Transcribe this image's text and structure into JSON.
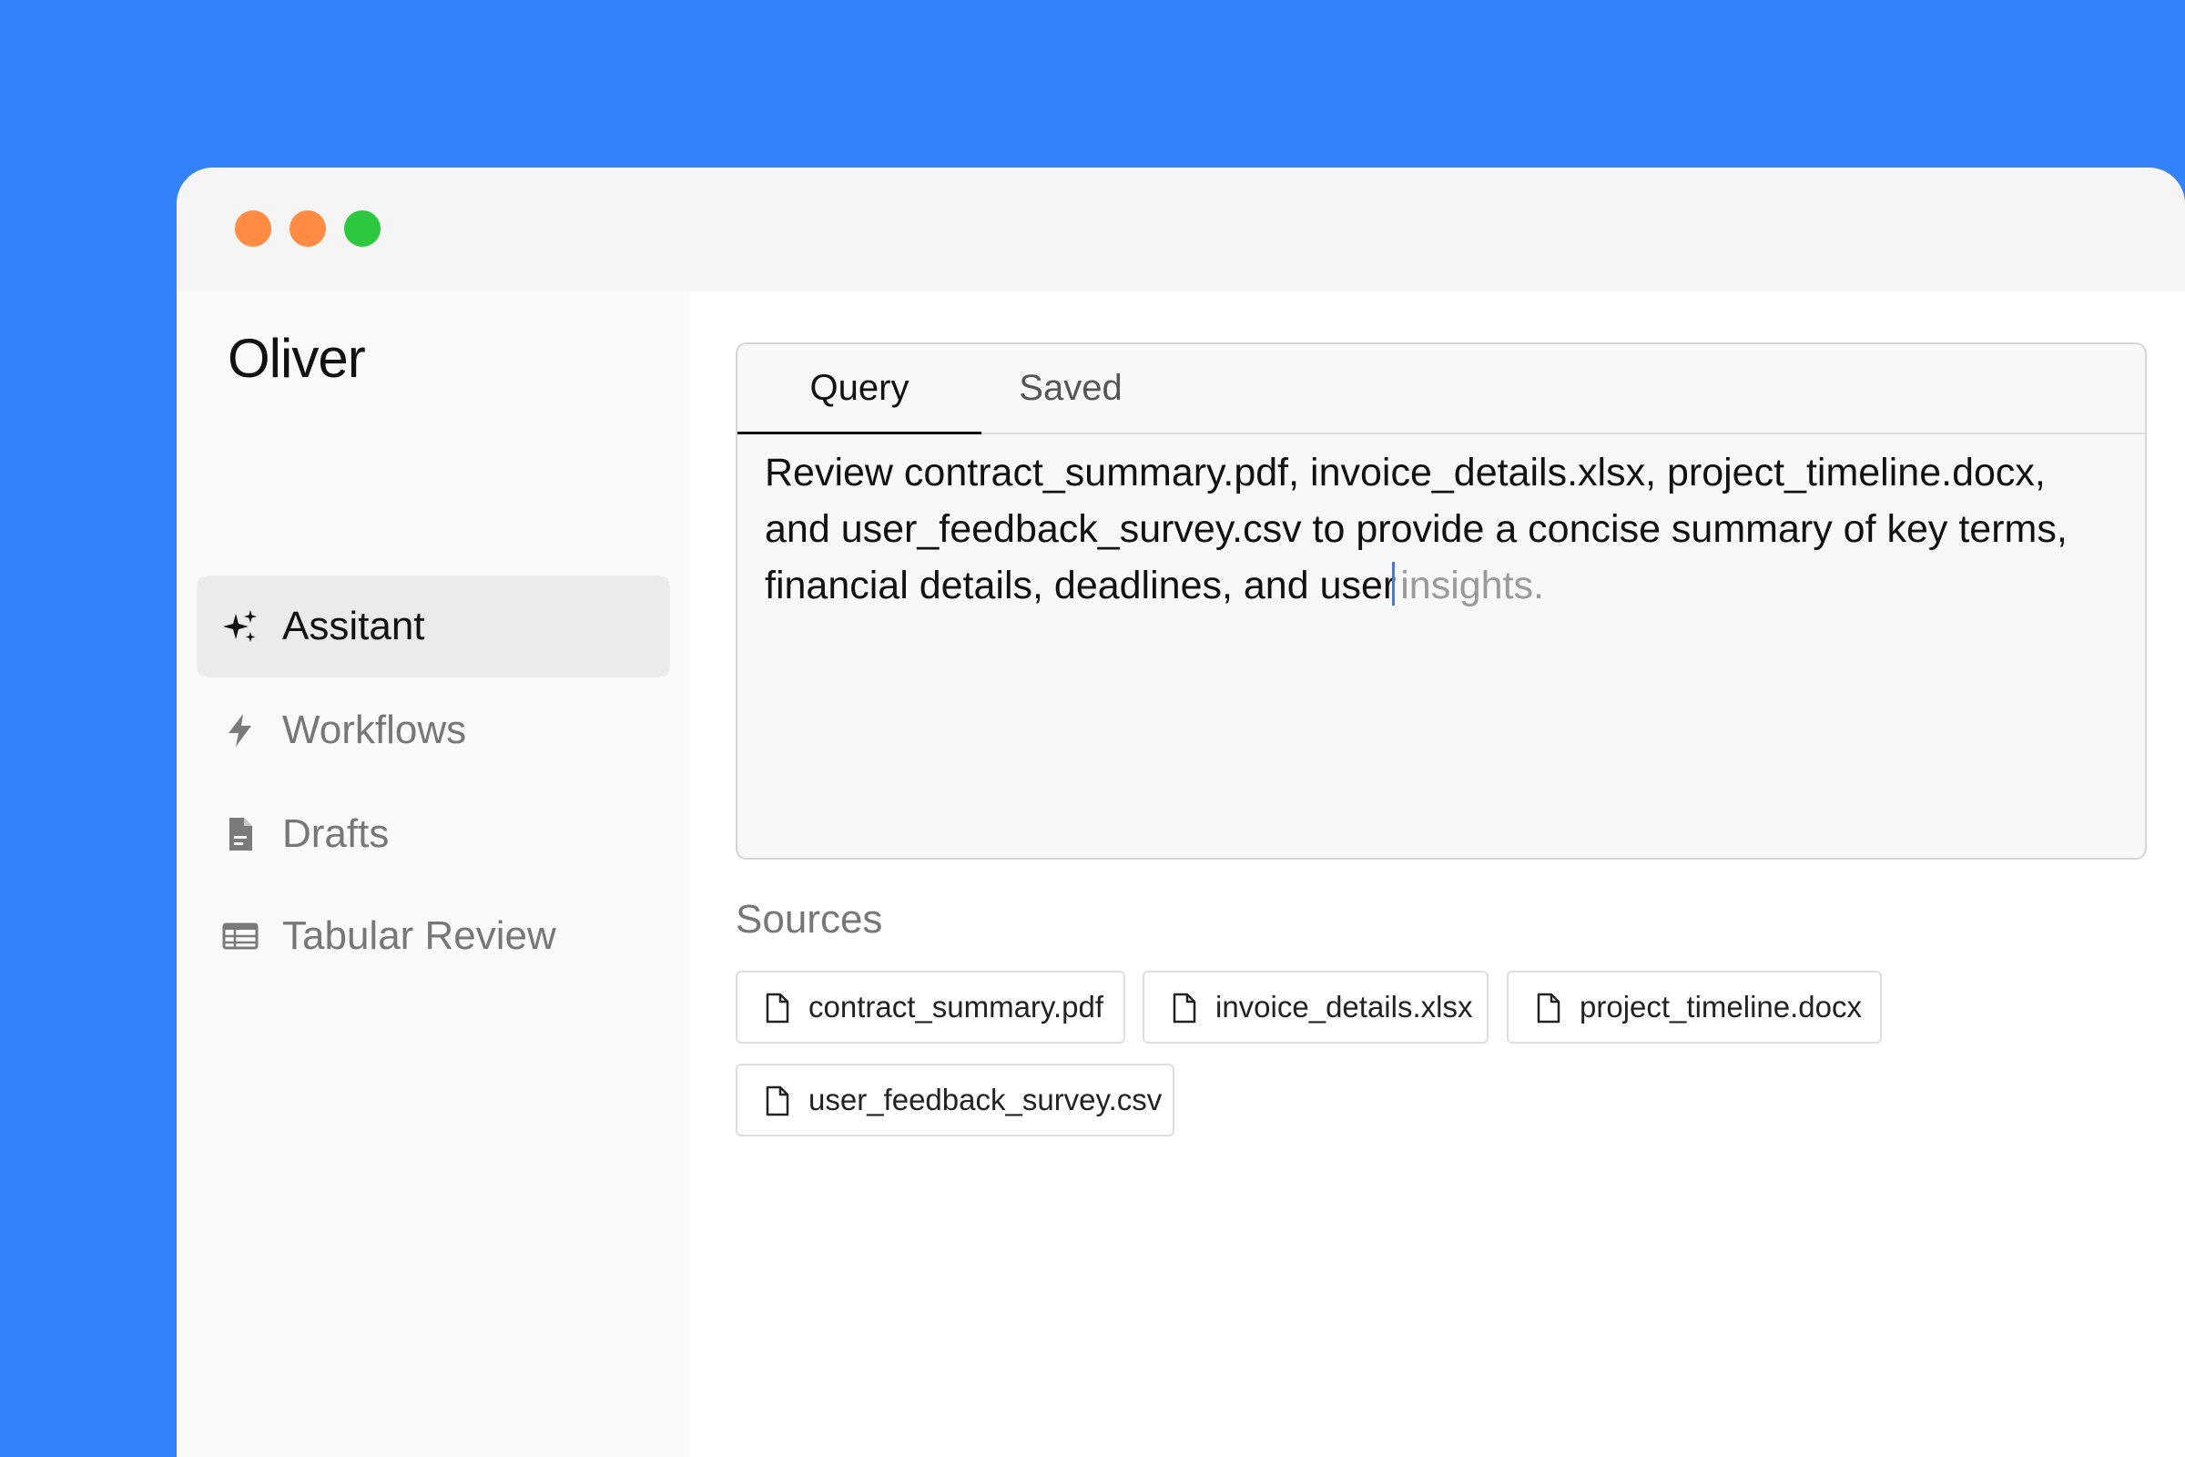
{
  "window": {
    "controls": [
      {
        "name": "close",
        "color": "#FF8C42"
      },
      {
        "name": "minimize",
        "color": "#FF8C42"
      },
      {
        "name": "maximize",
        "color": "#2DC840"
      }
    ]
  },
  "sidebar": {
    "app_name": "Oliver",
    "items": [
      {
        "label": "Assitant",
        "icon": "sparkles-icon",
        "active": true
      },
      {
        "label": "Workflows",
        "icon": "lightning-bolt-icon",
        "active": false
      },
      {
        "label": "Drafts",
        "icon": "document-icon",
        "active": false
      },
      {
        "label": "Tabular Review",
        "icon": "table-icon",
        "active": false
      }
    ]
  },
  "main": {
    "tabs": [
      {
        "label": "Query",
        "active": true
      },
      {
        "label": "Saved",
        "active": false
      }
    ],
    "query": {
      "typed_text": "Review contract_summary.pdf, invoice_details.xlsx, project_timeline.docx, and user_feedback_survey.csv to provide a concise summary of key terms, financial details, deadlines, and user",
      "suggestion_text": "insights."
    },
    "sources": {
      "label": "Sources",
      "files": [
        {
          "name": "contract_summary.pdf",
          "icon": "file-icon"
        },
        {
          "name": "invoice_details.xlsx",
          "icon": "file-icon"
        },
        {
          "name": "project_timeline.docx",
          "icon": "file-icon"
        },
        {
          "name": "user_feedback_survey.csv",
          "icon": "file-icon"
        }
      ]
    }
  },
  "colors": {
    "background": "#3381FB",
    "caret": "#3B7BEA",
    "active_nav_bg": "#EBEBEB"
  }
}
